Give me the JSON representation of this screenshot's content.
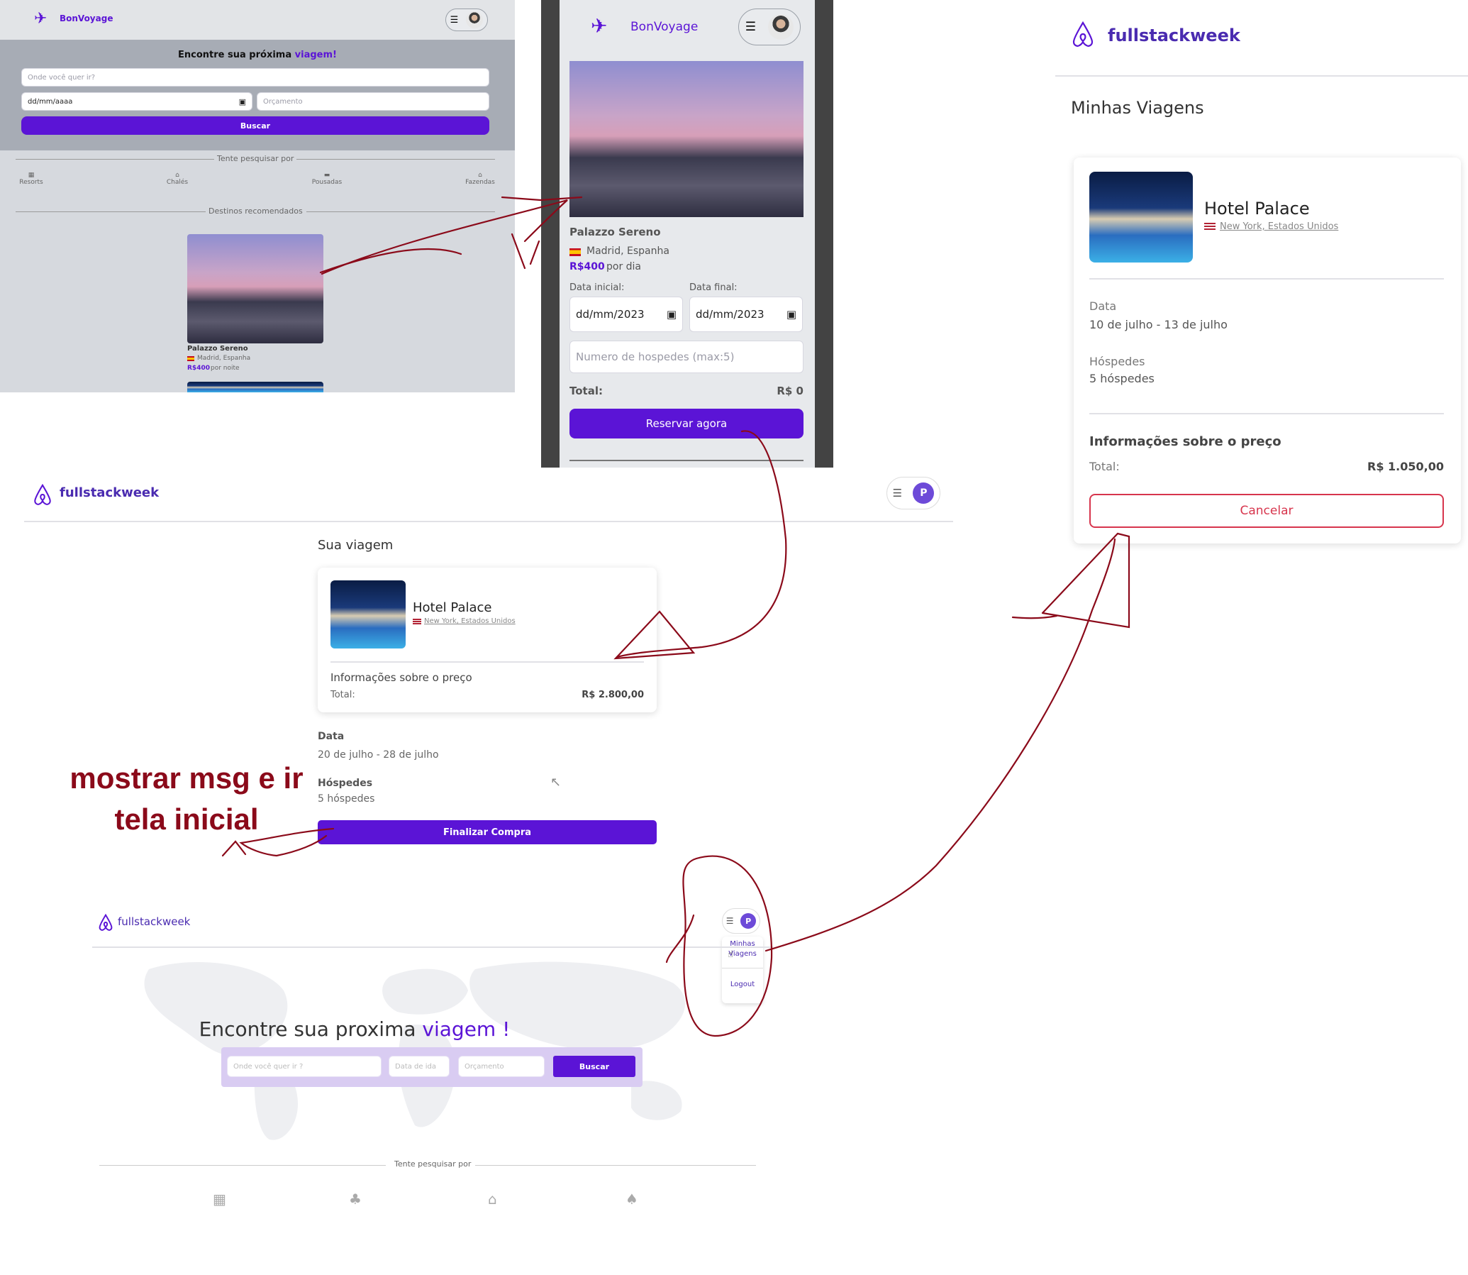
{
  "p1": {
    "brand": "BonVoyage",
    "heading_prefix": "Encontre sua próxima",
    "heading_accent": "viagem!",
    "where_placeholder": "Onde você quer ir?",
    "date_placeholder": "dd/mm/aaaa",
    "budget_placeholder": "Orçamento",
    "search_button": "Buscar",
    "try_search": "Tente pesquisar por",
    "categories": [
      "Resorts",
      "Chalés",
      "Pousadas",
      "Fazendas"
    ],
    "recommended": "Destinos recomendados",
    "card_name": "Palazzo Sereno",
    "card_location": "Madrid, Espanha",
    "card_price": "R$400",
    "card_price_suffix": "por noite"
  },
  "p2": {
    "brand": "BonVoyage",
    "name": "Palazzo Sereno",
    "location": "Madrid, Espanha",
    "price": "R$400",
    "price_suffix": "por dia",
    "start_label": "Data inicial:",
    "end_label": "Data final:",
    "start_value": "dd/mm/2023",
    "end_value": "dd/mm/2023",
    "guests_placeholder": "Numero de hospedes (max:5)",
    "total_label": "Total:",
    "total_value": "R$ 0",
    "reserve_button": "Reservar agora"
  },
  "p3": {
    "brand": "fullstackweek",
    "title": "Minhas Viagens",
    "hotel": "Hotel Palace",
    "location": "New York, Estados Unidos",
    "date_label": "Data",
    "date_value": "10 de julho - 13 de julho",
    "guests_label": "Hóspedes",
    "guests_value": "5 hóspedes",
    "price_info": "Informações sobre o preço",
    "total_label": "Total:",
    "total_value": "R$ 1.050,00",
    "cancel_button": "Cancelar"
  },
  "p4": {
    "brand": "fullstackweek",
    "avatar_letter": "P",
    "title": "Sua viagem",
    "hotel": "Hotel Palace",
    "location": "New York, Estados Unidos",
    "price_info": "Informações sobre o preço",
    "total_label": "Total:",
    "total_value": "R$ 2.800,00",
    "date_label": "Data",
    "date_value": "20 de julho - 28 de julho",
    "guests_label": "Hóspedes",
    "guests_value": "5 hóspedes",
    "finish_button": "Finalizar Compra"
  },
  "annotation": {
    "line1": "mostrar msg e ir",
    "line2": "tela inicial"
  },
  "p5": {
    "brand": "fullstackweek",
    "avatar_letter": "P",
    "menu_item1_line1": "Minhas",
    "menu_item1_line2": "Viagens",
    "menu_item2": "Logout",
    "heading_prefix": "Encontre sua proxima",
    "heading_accent": "viagem !",
    "where_placeholder": "Onde você quer ir ?",
    "date_placeholder": "Data de ida",
    "budget_placeholder": "Orçamento",
    "search_button": "Buscar",
    "try_search": "Tente pesquisar por"
  },
  "colors": {
    "accent": "#5b14d6",
    "annotation": "#8b0a1a",
    "cancel_border": "#d7354d"
  }
}
